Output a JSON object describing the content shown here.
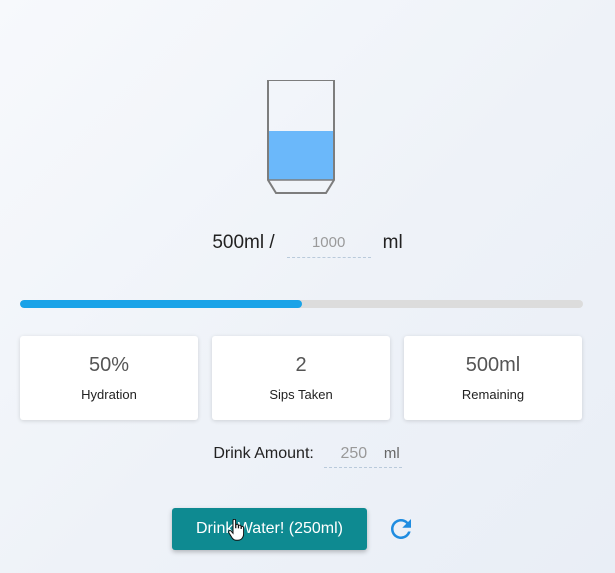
{
  "glass": {
    "fill_level": 0.5,
    "water_color": "#6bb8fa"
  },
  "goal": {
    "current_label": "500ml /",
    "target_placeholder": "1000",
    "unit": "ml"
  },
  "progress": {
    "value": 0.5,
    "color": "#1aa3e8"
  },
  "stats": [
    {
      "value": "50%",
      "label": "Hydration"
    },
    {
      "value": "2",
      "label": "Sips Taken"
    },
    {
      "value": "500ml",
      "label": "Remaining"
    }
  ],
  "drink_amount": {
    "label": "Drink Amount:",
    "placeholder": "250",
    "unit": "ml"
  },
  "actions": {
    "drink_label": "Drink Water! (250ml)",
    "drink_color": "#0e8a91",
    "reset_icon": "refresh-icon",
    "reset_color": "#1f8ce0"
  }
}
